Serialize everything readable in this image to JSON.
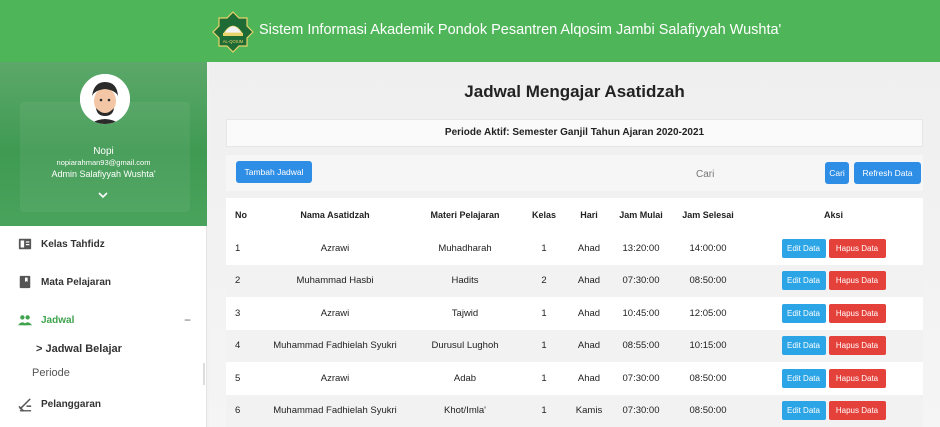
{
  "header": {
    "title": "Sistem Informasi Akademik Pondok Pesantren Alqosim Jambi Salafiyyah Wushta'",
    "logo_text": "AL-QOSIM",
    "logo_icon": "mosque-dome-logo-icon",
    "bg_color": "#4fb559"
  },
  "profile": {
    "name": "Nopi",
    "email": "nopiarahman93@gmail.com",
    "role": "Admin Salafiyyah Wushta'"
  },
  "sidebar": {
    "items": [
      {
        "label": "Kelas Tahfidz",
        "icon": "book-icon"
      },
      {
        "label": "Mata Pelajaran",
        "icon": "bookmark-icon"
      },
      {
        "label": "Jadwal",
        "icon": "users-icon",
        "expanded": true
      },
      {
        "label": "Pelanggaran",
        "icon": "scale-icon"
      }
    ],
    "jadwal_children": [
      {
        "label": "> Jadwal Belajar"
      },
      {
        "label": "Periode"
      }
    ],
    "collapse_symbol": "−"
  },
  "main": {
    "page_title": "Jadwal Mengajar Asatidzah",
    "period": "Periode Aktif: Semester Ganjil Tahun Ajaran 2020-2021",
    "add_button": "Tambah Jadwal",
    "search": {
      "placeholder": "Cari",
      "value": ""
    },
    "search_button": "Cari",
    "refresh_button": "Refresh Data",
    "table": {
      "headers": [
        "No",
        "Nama Asatidzah",
        "Materi Pelajaran",
        "Kelas",
        "Hari",
        "Jam Mulai",
        "Jam Selesai",
        "Aksi"
      ],
      "edit_label": "Edit Data",
      "delete_label": "Hapus Data",
      "rows": [
        {
          "no": "1",
          "nama": "Azrawi",
          "materi": "Muhadharah",
          "kelas": "1",
          "hari": "Ahad",
          "mulai": "13:20:00",
          "selesai": "14:00:00"
        },
        {
          "no": "2",
          "nama": "Muhammad Hasbi",
          "materi": "Hadits",
          "kelas": "2",
          "hari": "Ahad",
          "mulai": "07:30:00",
          "selesai": "08:50:00"
        },
        {
          "no": "3",
          "nama": "Azrawi",
          "materi": "Tajwid",
          "kelas": "1",
          "hari": "Ahad",
          "mulai": "10:45:00",
          "selesai": "12:05:00"
        },
        {
          "no": "4",
          "nama": "Muhammad Fadhielah Syukri",
          "materi": "Durusul Lughoh",
          "kelas": "1",
          "hari": "Ahad",
          "mulai": "08:55:00",
          "selesai": "10:15:00"
        },
        {
          "no": "5",
          "nama": "Azrawi",
          "materi": "Adab",
          "kelas": "1",
          "hari": "Ahad",
          "mulai": "07:30:00",
          "selesai": "08:50:00"
        },
        {
          "no": "6",
          "nama": "Muhammad Fadhielah Syukri",
          "materi": "Khot/Imla'",
          "kelas": "1",
          "hari": "Kamis",
          "mulai": "07:30:00",
          "selesai": "08:50:00"
        }
      ]
    }
  }
}
